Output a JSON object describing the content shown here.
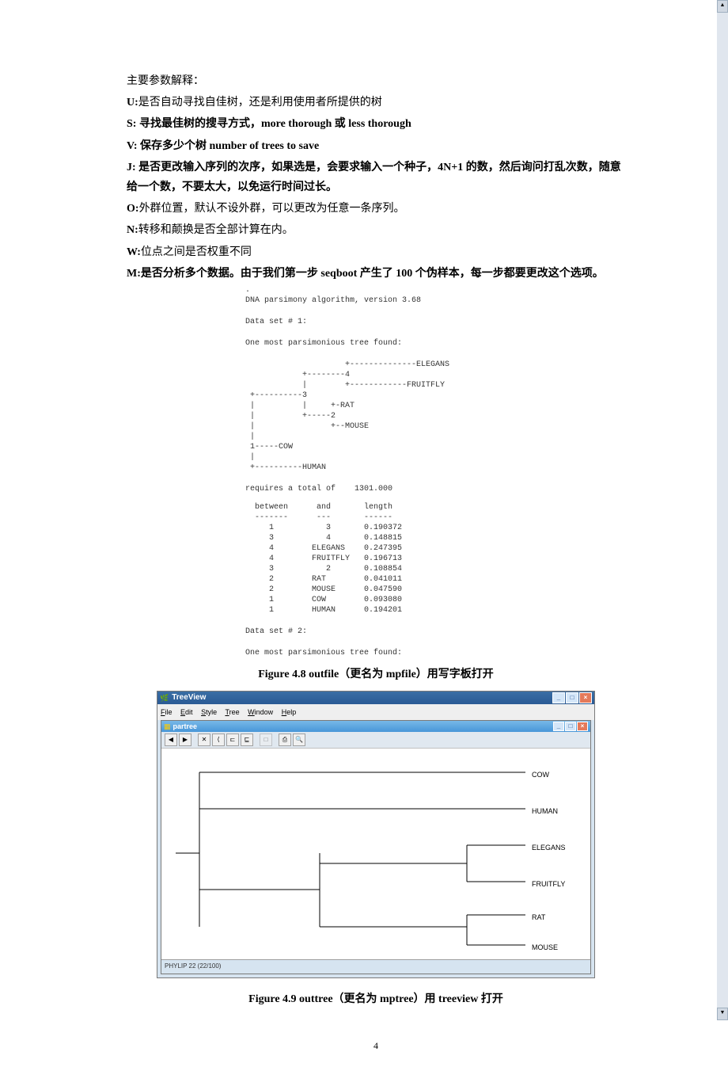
{
  "intro": "主要参数解释：",
  "params": {
    "U": {
      "key": "U:",
      "text": "是否自动寻找自佳树，还是利用使用者所提供的树"
    },
    "S": {
      "key": "S: ",
      "text": "寻找最佳树的搜寻方式，more thorough 或  less thorough"
    },
    "V": {
      "key": "V: ",
      "text": "保存多少个树  number of trees to save"
    },
    "J": {
      "key": "J: ",
      "text": "是否更改输入序列的次序，如果选是，会要求输入一个种子，4N+1 的数，然后询问打乱次数，随意给一个数，不要太大，以免运行时间过长。"
    },
    "O": {
      "key": "O:",
      "text": "外群位置，默认不设外群，可以更改为任意一条序列。"
    },
    "N": {
      "key": "N:",
      "text": "转移和颠换是否全部计算在内。"
    },
    "W": {
      "key": "W:",
      "text": "位点之间是否权重不同"
    },
    "M": {
      "key": "M:",
      "text": "是否分析多个数据。由于我们第一步 seqboot 产生了 100 个伪样本，每一步都要更改这个选项。"
    }
  },
  "outfile": {
    "header": ".\nDNA parsimony algorithm, version 3.68",
    "ds1": "Data set # 1:",
    "msg1": "One most parsimonious tree found:",
    "tree": "                     +--------------ELEGANS\n            +--------4\n            |        +------------FRUITFLY\n +----------3\n |          |     +-RAT\n |          +-----2\n |                +--MOUSE\n |\n 1-----COW\n |\n +----------HUMAN",
    "req": "requires a total of    1301.000",
    "tbl": "  between      and       length\n  -------      ---       ------\n     1           3       0.190372\n     3           4       0.148815\n     4        ELEGANS    0.247395\n     4        FRUITFLY   0.196713\n     3           2       0.108854\n     2        RAT        0.041011\n     2        MOUSE      0.047590\n     1        COW        0.093080\n     1        HUMAN      0.194201",
    "ds2": "Data set # 2:",
    "msg2": "One most parsimonious tree found:"
  },
  "cap1": "Figure 4.8 outfile（更名为 mpfile）用写字板打开",
  "cap2": "Figure 4.9 outtree（更名为 mptree）用 treeview 打开",
  "tv": {
    "title": "TreeView",
    "menu": {
      "file": "File",
      "edit": "Edit",
      "style": "Style",
      "tree": "Tree",
      "win": "Window",
      "help": "Help"
    },
    "doc": "partree",
    "status": "PHYLIP 22  (22/100)",
    "leaves": [
      "COW",
      "HUMAN",
      "ELEGANS",
      "FRUITFLY",
      "RAT",
      "MOUSE"
    ]
  },
  "page_no": "4"
}
